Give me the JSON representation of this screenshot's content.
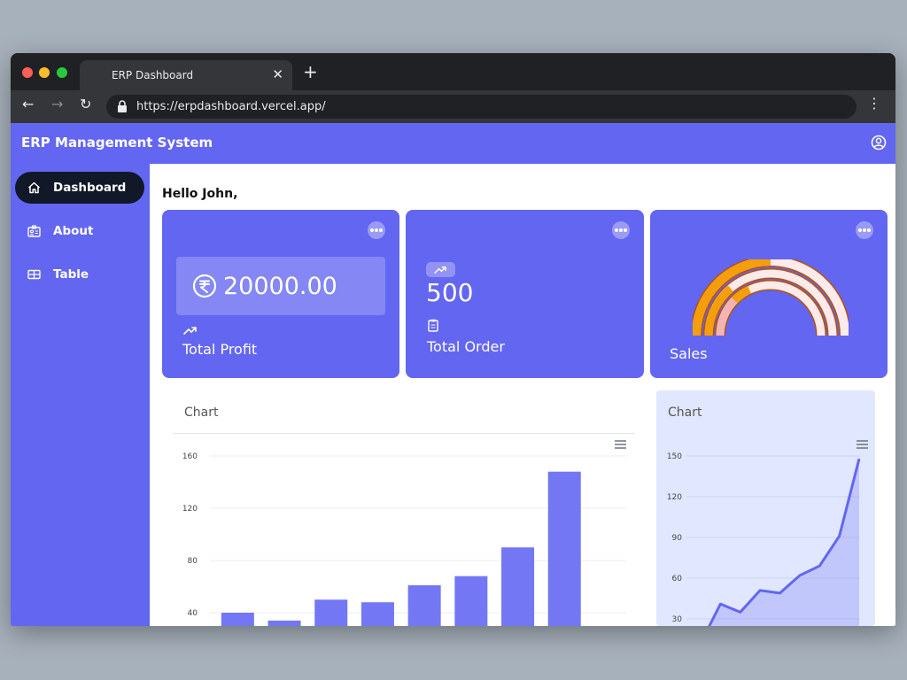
{
  "browser": {
    "tab_title": "ERP Dashboard",
    "tab_close": "✕",
    "new_tab": "+",
    "url": "https://erpdashboard.vercel.app/",
    "back": "←",
    "forward": "→",
    "reload": "↻",
    "menu": "⋮"
  },
  "app": {
    "title": "ERP Management System",
    "accent_color": "#6366f1",
    "account_icon": "account-circle-icon"
  },
  "sidebar": {
    "items": [
      {
        "label": "Dashboard",
        "icon": "home-icon",
        "active": true
      },
      {
        "label": "About",
        "icon": "id-card-icon",
        "active": false
      },
      {
        "label": "Table",
        "icon": "table-icon",
        "active": false
      }
    ]
  },
  "main": {
    "greeting": "Hello John,",
    "cards": [
      {
        "label": "Total Profit",
        "value": "20000.00",
        "icon": "rupee-icon",
        "trend_icon": "trending-up-icon"
      },
      {
        "label": "Total Order",
        "value": "500",
        "icon": "clipboard-icon",
        "trend_icon": "trending-up-icon"
      },
      {
        "label": "Sales",
        "icon": "gauge-chart-icon"
      }
    ]
  },
  "chart_data": [
    {
      "type": "bar",
      "title": "Chart",
      "ylim": [
        0,
        160
      ],
      "yticks": [
        40,
        80,
        120,
        160
      ],
      "values": [
        40,
        34,
        50,
        48,
        61,
        68,
        90,
        148
      ],
      "color": "#7477f3"
    },
    {
      "type": "area",
      "title": "Chart",
      "ylim": [
        0,
        150
      ],
      "yticks": [
        30,
        60,
        90,
        120,
        150
      ],
      "values": [
        12,
        41,
        35,
        51,
        49,
        62,
        69,
        91,
        148
      ],
      "color": "#6366f1"
    }
  ]
}
